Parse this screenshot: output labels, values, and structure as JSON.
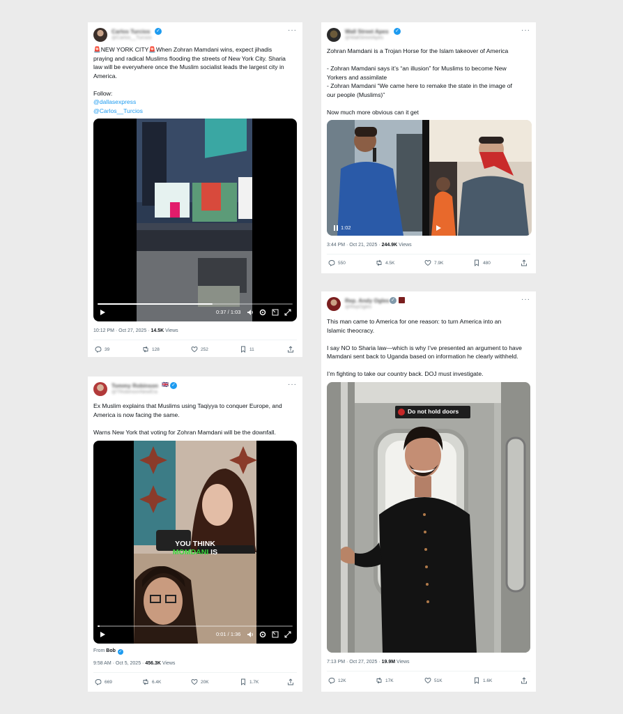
{
  "tweets": [
    {
      "author_name": "Carlos Turcios",
      "author_handle": "@Carlos__Turcios",
      "more_label": "···",
      "text_lines": [
        "🚨NEW YORK CITY🚨When Zohran Mamdani wins, expect jihadis",
        "praying and radical Muslims flooding the streets of New York City. Sharia",
        "law will be everywhere once the Muslim socialist leads the largest city in",
        "America.",
        "",
        "Follow:"
      ],
      "links": [
        "@dallasexpress",
        "@Carlos__Turcios"
      ],
      "video": {
        "time": "0:37 / 1:03",
        "progress": 0.59
      },
      "timestamp": "10:12 PM · Oct 27, 2025 · ",
      "views_count": "14.5K",
      "views_label": " Views",
      "replies": "39",
      "reposts": "128",
      "likes": "252",
      "bookmarks": "11"
    },
    {
      "author_name": "Wall Street Apes",
      "author_handle": "@WallStreetApes",
      "more_label": "···",
      "text_lines": [
        "Zohran Mamdani is a Trojan Horse for the Islam takeover of America",
        "",
        "- Zohran Mamdani says it’s “an illusion” for Muslims to become New",
        "Yorkers and assimilate",
        "- Zohran Mamdani “We came here to remake the state in the image of",
        "our people (Muslims)”",
        "",
        "Now much more obvious can it get"
      ],
      "video": {
        "time": "1:02"
      },
      "timestamp": "3:44 PM · Oct 21, 2025 · ",
      "views_count": "244.9K",
      "views_label": " Views",
      "replies": "550",
      "reposts": "4.5K",
      "likes": "7.9K",
      "bookmarks": "480"
    },
    {
      "author_name": "Tommy Robinson",
      "author_handle": "@TRobinsonNewEra",
      "flag": "🇬🇧",
      "more_label": "···",
      "text_lines": [
        "Ex Muslim explains that Muslims using Taqiyya to conquer Europe, and",
        "America is now facing the same.",
        "",
        "Warns New York that voting for Zohran Mamdani will be the downfall."
      ],
      "caption_line1": "YOU THINK",
      "caption_word_green": "MOMDANI",
      "caption_word_white": " IS",
      "video": {
        "time": "0:01 / 1:36",
        "progress": 0.01
      },
      "from_label": "From ",
      "from_name": "Bob",
      "timestamp": "9:58 AM · Oct 5, 2025 · ",
      "views_count": "456.3K",
      "views_label": " Views",
      "replies": "669",
      "reposts": "6.4K",
      "likes": "20K",
      "bookmarks": "1.7K"
    },
    {
      "author_name": "Rep. Andy Ogles",
      "author_handle": "@RepOgles",
      "more_label": "···",
      "text_lines": [
        "This man came to America for one reason: to turn America into an",
        "Islamic theocracy.",
        "",
        "I say NO to Sharia law—which is why I’ve presented an argument to have",
        "Mamdani sent back to Uganda based on information he clearly withheld.",
        "",
        "I’m fighting to take our country back. DOJ must investigate."
      ],
      "sign_text": "Do not hold doors",
      "timestamp": "7:13 PM · Oct 27, 2025 · ",
      "views_count": "19.9M",
      "views_label": " Views",
      "replies": "12K",
      "reposts": "17K",
      "likes": "51K",
      "bookmarks": "1.6K"
    }
  ]
}
